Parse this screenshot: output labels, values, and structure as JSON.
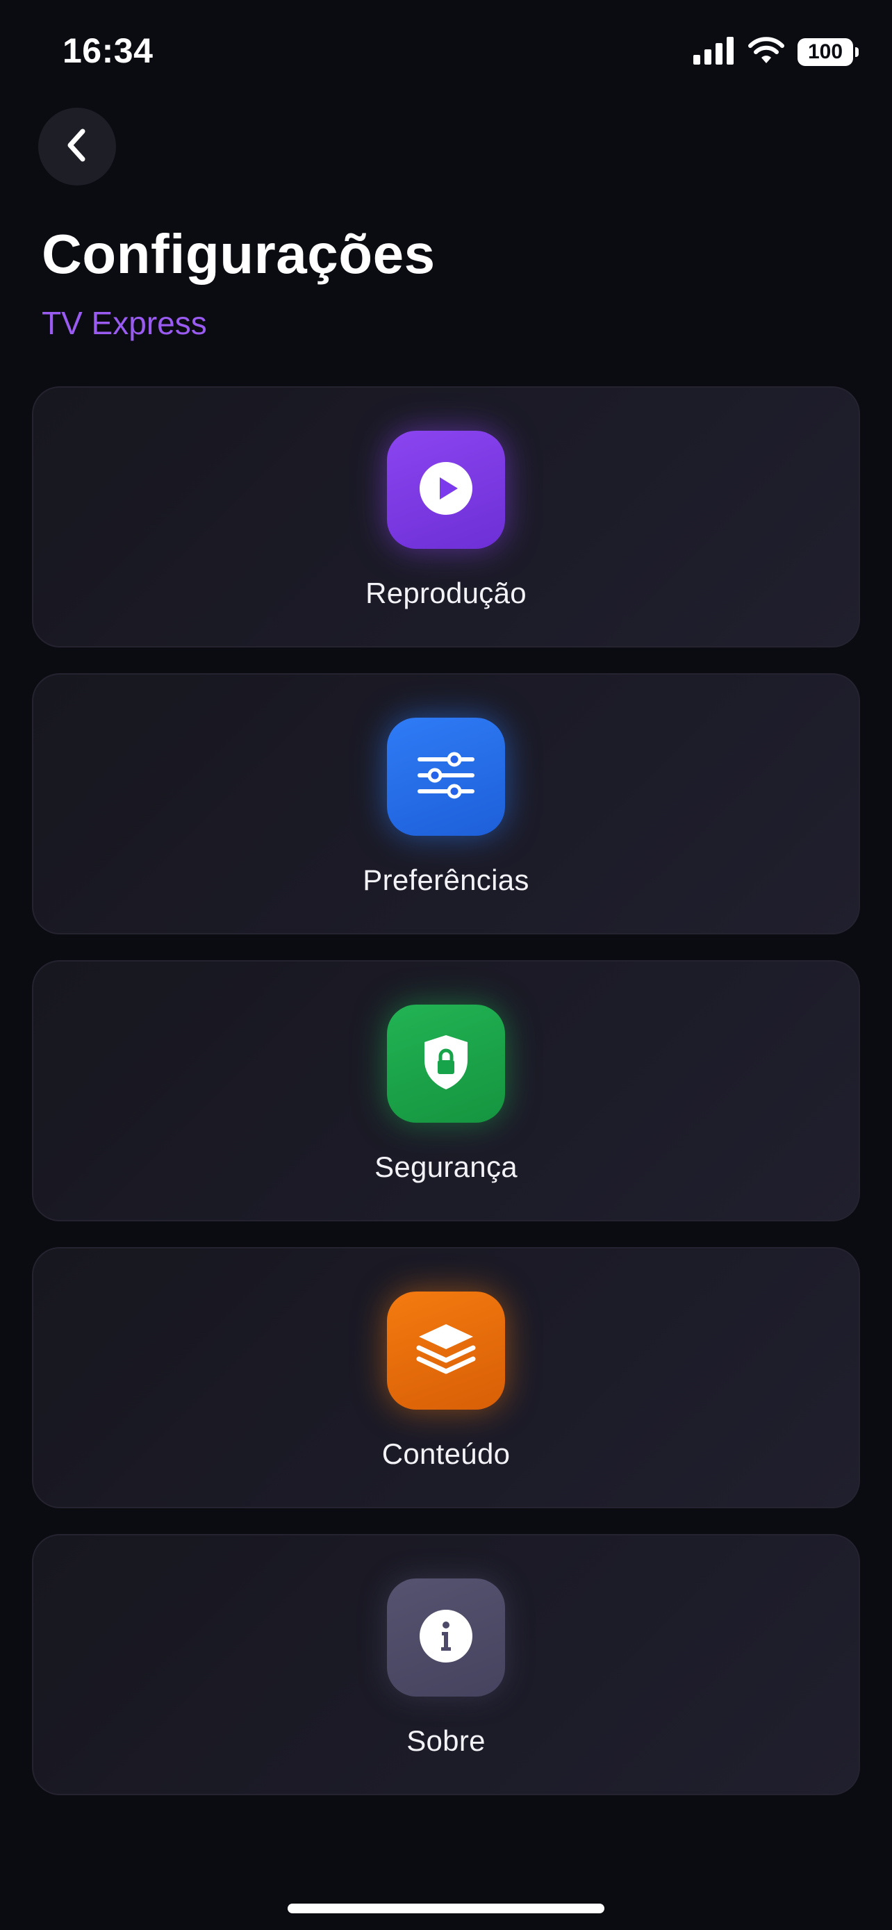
{
  "status_bar": {
    "time": "16:34",
    "battery": "100"
  },
  "header": {
    "back_icon": "chevron-left-icon",
    "title": "Configurações",
    "subtitle": "TV Express"
  },
  "cards": [
    {
      "label": "Reprodução",
      "icon": "play-icon",
      "color": "#7c3aed"
    },
    {
      "label": "Preferências",
      "icon": "sliders-icon",
      "color": "#2563eb"
    },
    {
      "label": "Segurança",
      "icon": "shield-lock-icon",
      "color": "#16a34a"
    },
    {
      "label": "Conteúdo",
      "icon": "layers-icon",
      "color": "#ea6a0a"
    },
    {
      "label": "Sobre",
      "icon": "info-icon",
      "color": "#4c4a68"
    }
  ],
  "colors": {
    "background": "#0b0b12",
    "accent": "#9a5cf0"
  }
}
